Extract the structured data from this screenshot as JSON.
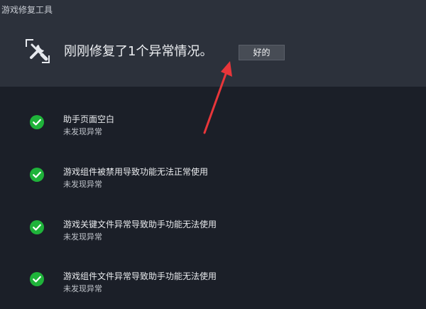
{
  "window": {
    "title": "游戏修复工具"
  },
  "summary": {
    "message": "刚刚修复了1个异常情况。",
    "ok_label": "好的",
    "icon": "wrench-screwdriver-icon",
    "arrow_color": "#e8363a"
  },
  "checks": {
    "items": [
      {
        "title": "助手页面空白",
        "status": "未发现异常",
        "icon": "check-circle-icon"
      },
      {
        "title": "游戏组件被禁用导致功能无法正常使用",
        "status": "未发现异常",
        "icon": "check-circle-icon"
      },
      {
        "title": "游戏关键文件异常导致助手功能无法使用",
        "status": "未发现异常",
        "icon": "check-circle-icon"
      },
      {
        "title": "游戏组件文件异常导致助手功能无法使用",
        "status": "未发现异常",
        "icon": "check-circle-icon"
      }
    ],
    "status_color": "#1fb33a"
  },
  "colors": {
    "header_bg": "#2c313b",
    "body_bg": "#1b1f28"
  }
}
